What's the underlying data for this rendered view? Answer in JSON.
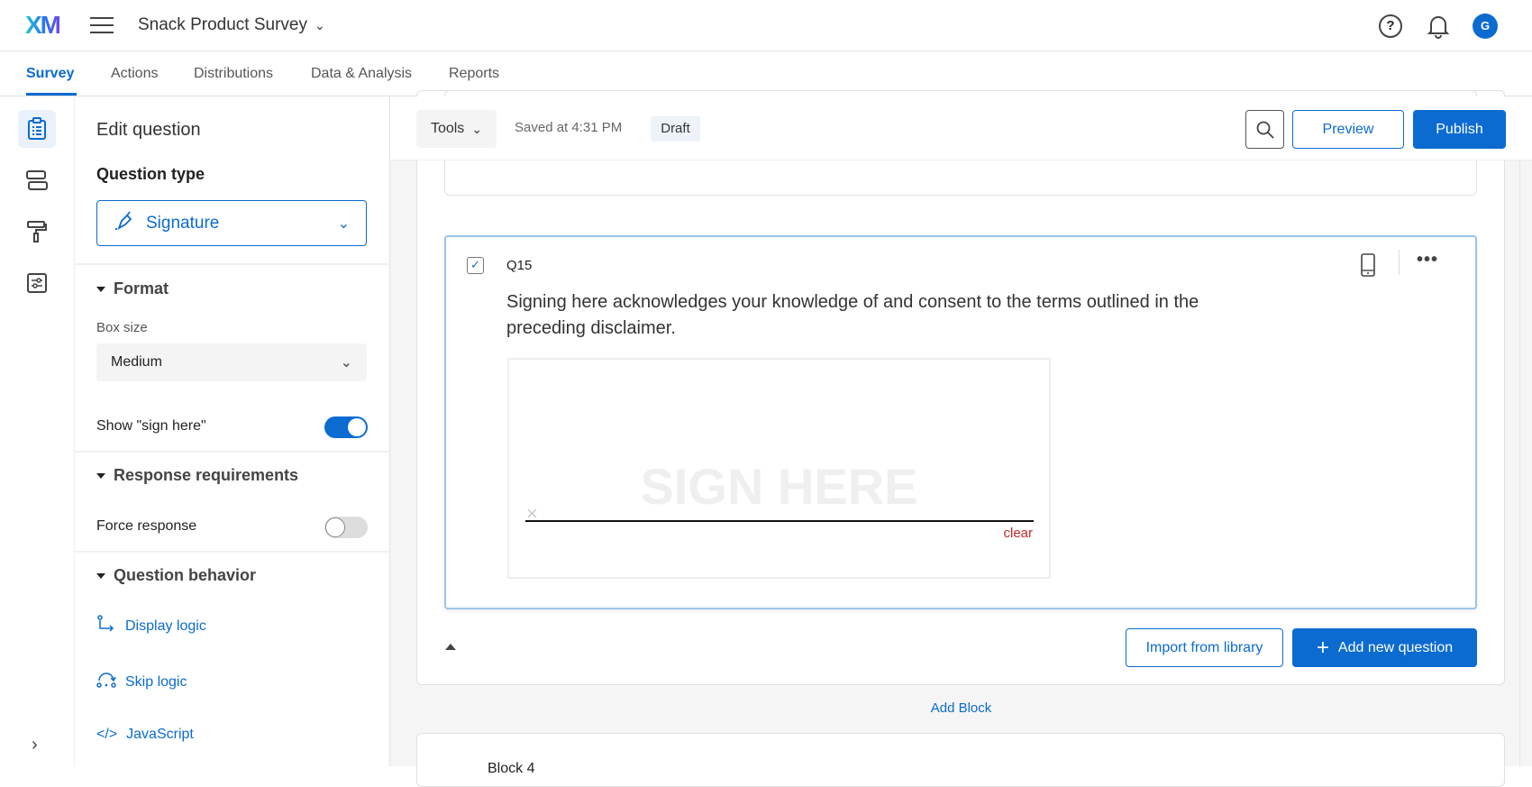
{
  "header": {
    "logo": "XM",
    "survey_title": "Snack Product Survey",
    "avatar_initial": "G",
    "help": "?"
  },
  "tabs": [
    {
      "label": "Survey",
      "active": true
    },
    {
      "label": "Actions"
    },
    {
      "label": "Distributions"
    },
    {
      "label": "Data & Analysis"
    },
    {
      "label": "Reports"
    }
  ],
  "panel": {
    "title": "Edit question",
    "question_type_label": "Question type",
    "question_type_value": "Signature",
    "format": {
      "heading": "Format",
      "box_size_label": "Box size",
      "box_size_value": "Medium",
      "show_sign_here_label": "Show \"sign here\"",
      "show_sign_here": true
    },
    "response": {
      "heading": "Response requirements",
      "force_response_label": "Force response",
      "force_response": false
    },
    "behavior": {
      "heading": "Question behavior",
      "links": [
        "Display logic",
        "Skip logic",
        "JavaScript"
      ]
    }
  },
  "toolbar": {
    "tools": "Tools",
    "saved": "Saved at 4:31 PM",
    "status": "Draft",
    "preview": "Preview",
    "publish": "Publish"
  },
  "question": {
    "number": "Q15",
    "text": "Signing here acknowledges your knowledge of and consent to the terms outlined in the preceding disclaimer.",
    "sign_here": "SIGN HERE",
    "clear": "clear"
  },
  "block": {
    "import": "Import from library",
    "add_question": "Add new question",
    "add_block": "Add Block",
    "next_block": "Block 4"
  },
  "colors": {
    "accent": "#0b6bd1",
    "clear": "#c62828"
  }
}
